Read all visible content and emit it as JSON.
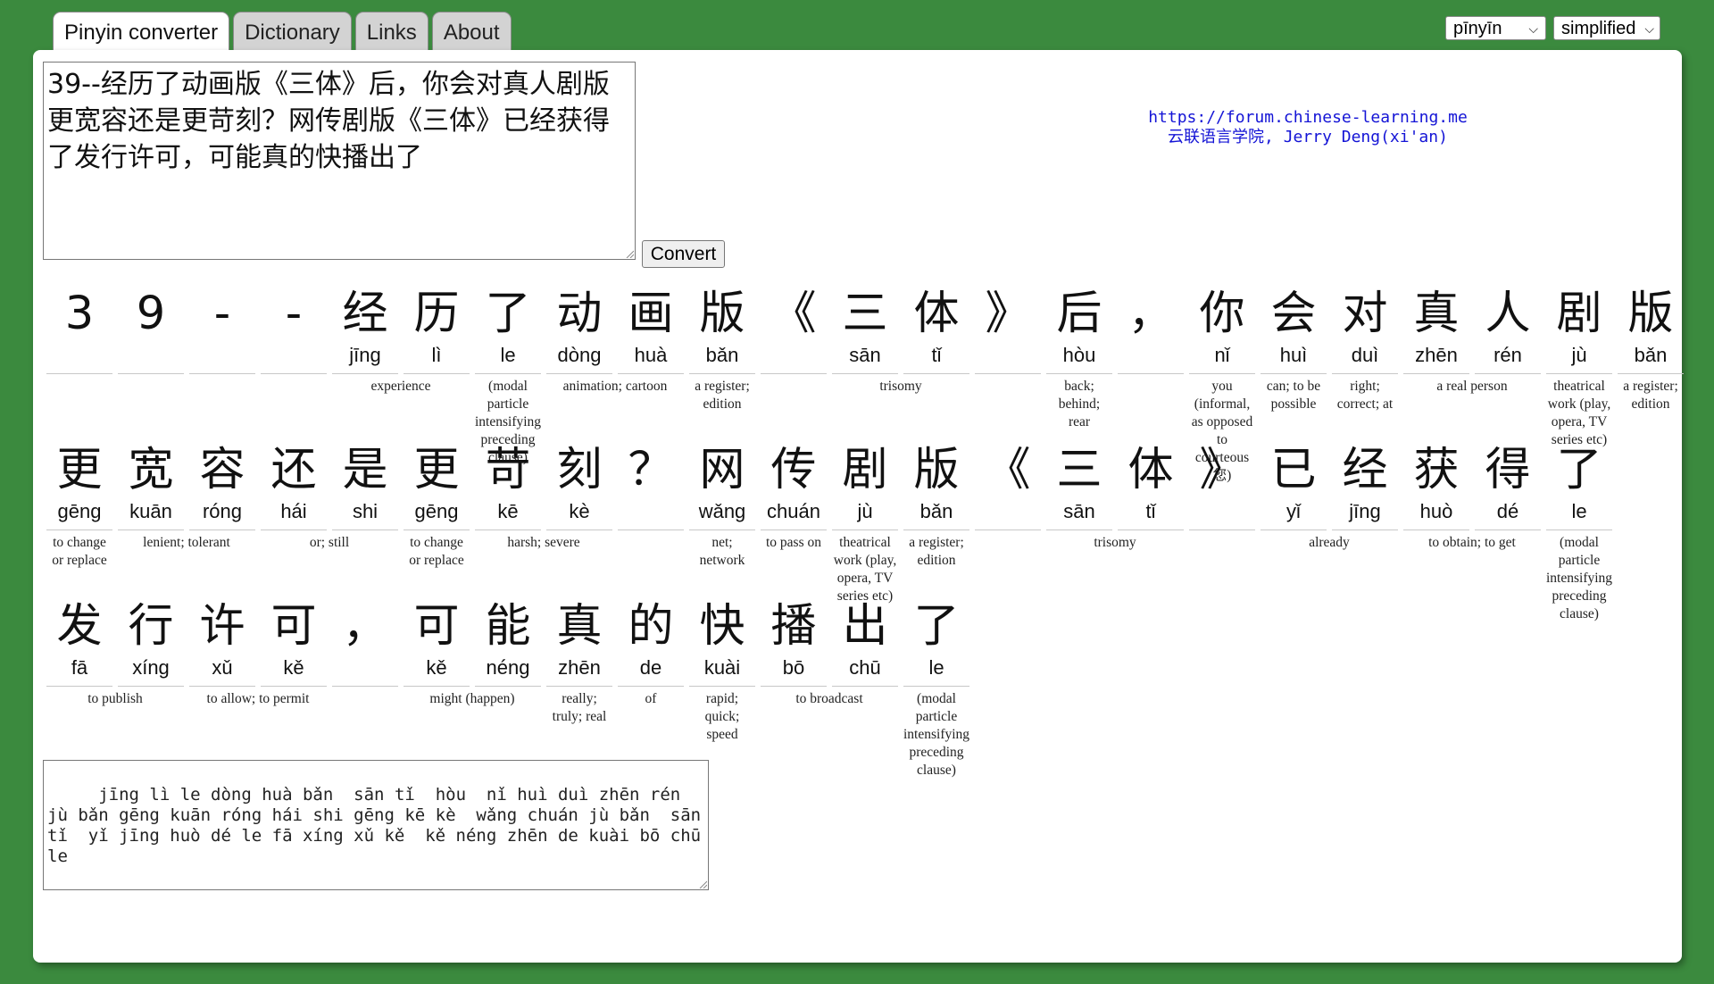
{
  "tabs": [
    {
      "label": "Pinyin converter",
      "active": true
    },
    {
      "label": "Dictionary",
      "active": false
    },
    {
      "label": "Links",
      "active": false
    },
    {
      "label": "About",
      "active": false
    }
  ],
  "selects": {
    "tone_mode": "pīnyīn",
    "script": "simplified"
  },
  "input": {
    "text": "39--经历了动画版《三体》后，你会对真人剧版更宽容还是更苛刻？网传剧版《三体》已经获得了发行许可，可能真的快播出了"
  },
  "convert_label": "Convert",
  "credit": {
    "line1": "https://forum.chinese-learning.me",
    "line2": "云联语言学院, Jerry Deng(xi'an)"
  },
  "rows": [
    {
      "chars": [
        {
          "hz": "3",
          "py": ""
        },
        {
          "hz": "9",
          "py": ""
        },
        {
          "hz": "-",
          "py": ""
        },
        {
          "hz": "-",
          "py": ""
        },
        {
          "hz": "经",
          "py": "jīng"
        },
        {
          "hz": "历",
          "py": "lì"
        },
        {
          "hz": "了",
          "py": "le"
        },
        {
          "hz": "动",
          "py": "dòng"
        },
        {
          "hz": "画",
          "py": "huà"
        },
        {
          "hz": "版",
          "py": "bǎn"
        },
        {
          "hz": "《",
          "py": ""
        },
        {
          "hz": "三",
          "py": "sān"
        },
        {
          "hz": "体",
          "py": "tǐ"
        },
        {
          "hz": "》",
          "py": ""
        },
        {
          "hz": "后",
          "py": "hòu"
        },
        {
          "hz": "，",
          "py": ""
        },
        {
          "hz": "你",
          "py": "nǐ"
        },
        {
          "hz": "会",
          "py": "huì"
        },
        {
          "hz": "对",
          "py": "duì"
        },
        {
          "hz": "真",
          "py": "zhēn"
        },
        {
          "hz": "人",
          "py": "rén"
        },
        {
          "hz": "剧",
          "py": "jù"
        },
        {
          "hz": "版",
          "py": "bǎn"
        }
      ],
      "glosses": [
        {
          "start": 4,
          "span": 2,
          "text": "experience"
        },
        {
          "start": 6,
          "span": 1,
          "text": "(modal particle intensifying preceding clause)"
        },
        {
          "start": 7,
          "span": 2,
          "text": "animation; cartoon"
        },
        {
          "start": 9,
          "span": 1,
          "text": "a register; edition"
        },
        {
          "start": 11,
          "span": 2,
          "text": "trisomy"
        },
        {
          "start": 14,
          "span": 1,
          "text": "back; behind; rear"
        },
        {
          "start": 16,
          "span": 1,
          "text": "you (informal, as opposed to courteous 您)"
        },
        {
          "start": 17,
          "span": 1,
          "text": "can; to be possible"
        },
        {
          "start": 18,
          "span": 1,
          "text": "right; correct; at"
        },
        {
          "start": 19,
          "span": 2,
          "text": "a real person"
        },
        {
          "start": 21,
          "span": 1,
          "text": "theatrical work (play, opera, TV series etc)"
        },
        {
          "start": 22,
          "span": 1,
          "text": "a register; edition"
        }
      ]
    },
    {
      "chars": [
        {
          "hz": "更",
          "py": "gēng"
        },
        {
          "hz": "宽",
          "py": "kuān"
        },
        {
          "hz": "容",
          "py": "róng"
        },
        {
          "hz": "还",
          "py": "hái"
        },
        {
          "hz": "是",
          "py": "shi"
        },
        {
          "hz": "更",
          "py": "gēng"
        },
        {
          "hz": "苛",
          "py": "kē"
        },
        {
          "hz": "刻",
          "py": "kè"
        },
        {
          "hz": "？",
          "py": ""
        },
        {
          "hz": "网",
          "py": "wǎng"
        },
        {
          "hz": "传",
          "py": "chuán"
        },
        {
          "hz": "剧",
          "py": "jù"
        },
        {
          "hz": "版",
          "py": "bǎn"
        },
        {
          "hz": "《",
          "py": ""
        },
        {
          "hz": "三",
          "py": "sān"
        },
        {
          "hz": "体",
          "py": "tǐ"
        },
        {
          "hz": "》",
          "py": ""
        },
        {
          "hz": "已",
          "py": "yǐ"
        },
        {
          "hz": "经",
          "py": "jīng"
        },
        {
          "hz": "获",
          "py": "huò"
        },
        {
          "hz": "得",
          "py": "dé"
        },
        {
          "hz": "了",
          "py": "le"
        }
      ],
      "glosses": [
        {
          "start": 0,
          "span": 1,
          "text": "to change or replace"
        },
        {
          "start": 1,
          "span": 2,
          "text": "lenient; tolerant"
        },
        {
          "start": 3,
          "span": 2,
          "text": "or; still"
        },
        {
          "start": 5,
          "span": 1,
          "text": "to change or replace"
        },
        {
          "start": 6,
          "span": 2,
          "text": "harsh; severe"
        },
        {
          "start": 9,
          "span": 1,
          "text": "net; network"
        },
        {
          "start": 10,
          "span": 1,
          "text": "to pass on"
        },
        {
          "start": 11,
          "span": 1,
          "text": "theatrical work (play, opera, TV series etc)"
        },
        {
          "start": 12,
          "span": 1,
          "text": "a register; edition"
        },
        {
          "start": 14,
          "span": 2,
          "text": "trisomy"
        },
        {
          "start": 17,
          "span": 2,
          "text": "already"
        },
        {
          "start": 19,
          "span": 2,
          "text": "to obtain; to get"
        },
        {
          "start": 21,
          "span": 1,
          "text": "(modal particle intensifying preceding clause)"
        }
      ]
    },
    {
      "chars": [
        {
          "hz": "发",
          "py": "fā"
        },
        {
          "hz": "行",
          "py": "xíng"
        },
        {
          "hz": "许",
          "py": "xǔ"
        },
        {
          "hz": "可",
          "py": "kě"
        },
        {
          "hz": "，",
          "py": ""
        },
        {
          "hz": "可",
          "py": "kě"
        },
        {
          "hz": "能",
          "py": "néng"
        },
        {
          "hz": "真",
          "py": "zhēn"
        },
        {
          "hz": "的",
          "py": "de"
        },
        {
          "hz": "快",
          "py": "kuài"
        },
        {
          "hz": "播",
          "py": "bō"
        },
        {
          "hz": "出",
          "py": "chū"
        },
        {
          "hz": "了",
          "py": "le"
        }
      ],
      "glosses": [
        {
          "start": 0,
          "span": 2,
          "text": "to publish"
        },
        {
          "start": 2,
          "span": 2,
          "text": "to allow; to permit"
        },
        {
          "start": 5,
          "span": 2,
          "text": "might (happen)"
        },
        {
          "start": 7,
          "span": 1,
          "text": "really; truly; real"
        },
        {
          "start": 8,
          "span": 1,
          "text": "of"
        },
        {
          "start": 9,
          "span": 1,
          "text": "rapid; quick; speed"
        },
        {
          "start": 10,
          "span": 2,
          "text": "to broadcast"
        },
        {
          "start": 12,
          "span": 1,
          "text": "(modal particle intensifying preceding clause)"
        }
      ]
    }
  ],
  "output": {
    "text": "   jīng lì le dòng huà bǎn  sān tǐ  hòu  nǐ huì duì zhēn rén jù bǎn gēng kuān róng hái shi gēng kē kè  wǎng chuán jù bǎn  sān tǐ  yǐ jīng huò dé le fā xíng xǔ kě  kě néng zhēn de kuài bō chū le"
  }
}
